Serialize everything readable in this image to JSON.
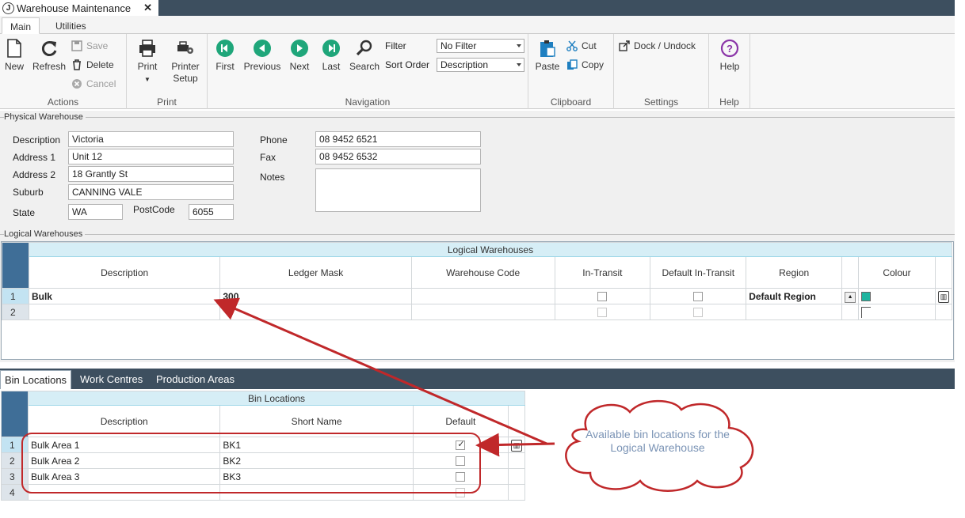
{
  "window": {
    "title": "Warehouse Maintenance",
    "close_icon": "close-icon"
  },
  "ribbon_tabs": [
    "Main",
    "Utilities"
  ],
  "ribbon": {
    "actions": {
      "new": "New",
      "refresh": "Refresh",
      "save": "Save",
      "delete": "Delete",
      "cancel": "Cancel",
      "group": "Actions"
    },
    "print": {
      "print": "Print",
      "printer_setup_1": "Printer",
      "printer_setup_2": "Setup",
      "group": "Print"
    },
    "navigation": {
      "first": "First",
      "previous": "Previous",
      "next": "Next",
      "last": "Last",
      "search": "Search",
      "filter_label": "Filter",
      "filter_value": "No Filter",
      "sort_label": "Sort Order",
      "sort_value": "Description",
      "group": "Navigation"
    },
    "clipboard": {
      "paste": "Paste",
      "cut": "Cut",
      "copy": "Copy",
      "group": "Clipboard"
    },
    "settings": {
      "dock": "Dock / Undock",
      "group": "Settings"
    },
    "help": {
      "help": "Help",
      "group": "Help"
    }
  },
  "physical": {
    "section": "Physical Warehouse",
    "description_label": "Description",
    "description": "Victoria",
    "address1_label": "Address 1",
    "address1": "Unit 12",
    "address2_label": "Address 2",
    "address2": "18 Grantly St",
    "suburb_label": "Suburb",
    "suburb": "CANNING VALE",
    "state_label": "State",
    "state": "WA",
    "postcode_label": "PostCode",
    "postcode": "6055",
    "phone_label": "Phone",
    "phone": "08 9452 6521",
    "fax_label": "Fax",
    "fax": "08 9452 6532",
    "notes_label": "Notes",
    "notes": ""
  },
  "logical": {
    "section": "Logical Warehouses",
    "grid_title": "Logical Warehouses",
    "columns": [
      "Description",
      "Ledger Mask",
      "Warehouse Code",
      "In-Transit",
      "Default In-Transit",
      "Region",
      "Colour"
    ],
    "rows": [
      {
        "num": "1",
        "description": "Bulk",
        "ledger_mask": "300",
        "warehouse_code": "",
        "in_transit": false,
        "default_in_transit": false,
        "region": "Default Region",
        "colour": "#1fb5a0"
      },
      {
        "num": "2",
        "description": "",
        "ledger_mask": "",
        "warehouse_code": "",
        "in_transit": false,
        "default_in_transit": false,
        "region": "",
        "colour": ""
      }
    ]
  },
  "bottom_tabs": [
    "Bin Locations",
    "Work Centres",
    "Production Areas"
  ],
  "bins": {
    "grid_title": "Bin Locations",
    "columns": [
      "Description",
      "Short Name",
      "Default"
    ],
    "rows": [
      {
        "num": "1",
        "description": "Bulk Area 1",
        "short_name": "BK1",
        "default": true
      },
      {
        "num": "2",
        "description": "Bulk Area 2",
        "short_name": "BK2",
        "default": false
      },
      {
        "num": "3",
        "description": "Bulk Area 3",
        "short_name": "BK3",
        "default": false
      },
      {
        "num": "4",
        "description": "",
        "short_name": "",
        "default": false
      }
    ]
  },
  "callout": {
    "text": "Available bin locations for the Logical Warehouse"
  },
  "colors": {
    "header": "#3d4f5f",
    "grid_title": "#d6eef6",
    "annotation": "#c0282a",
    "callout_text": "#7a93b5"
  }
}
